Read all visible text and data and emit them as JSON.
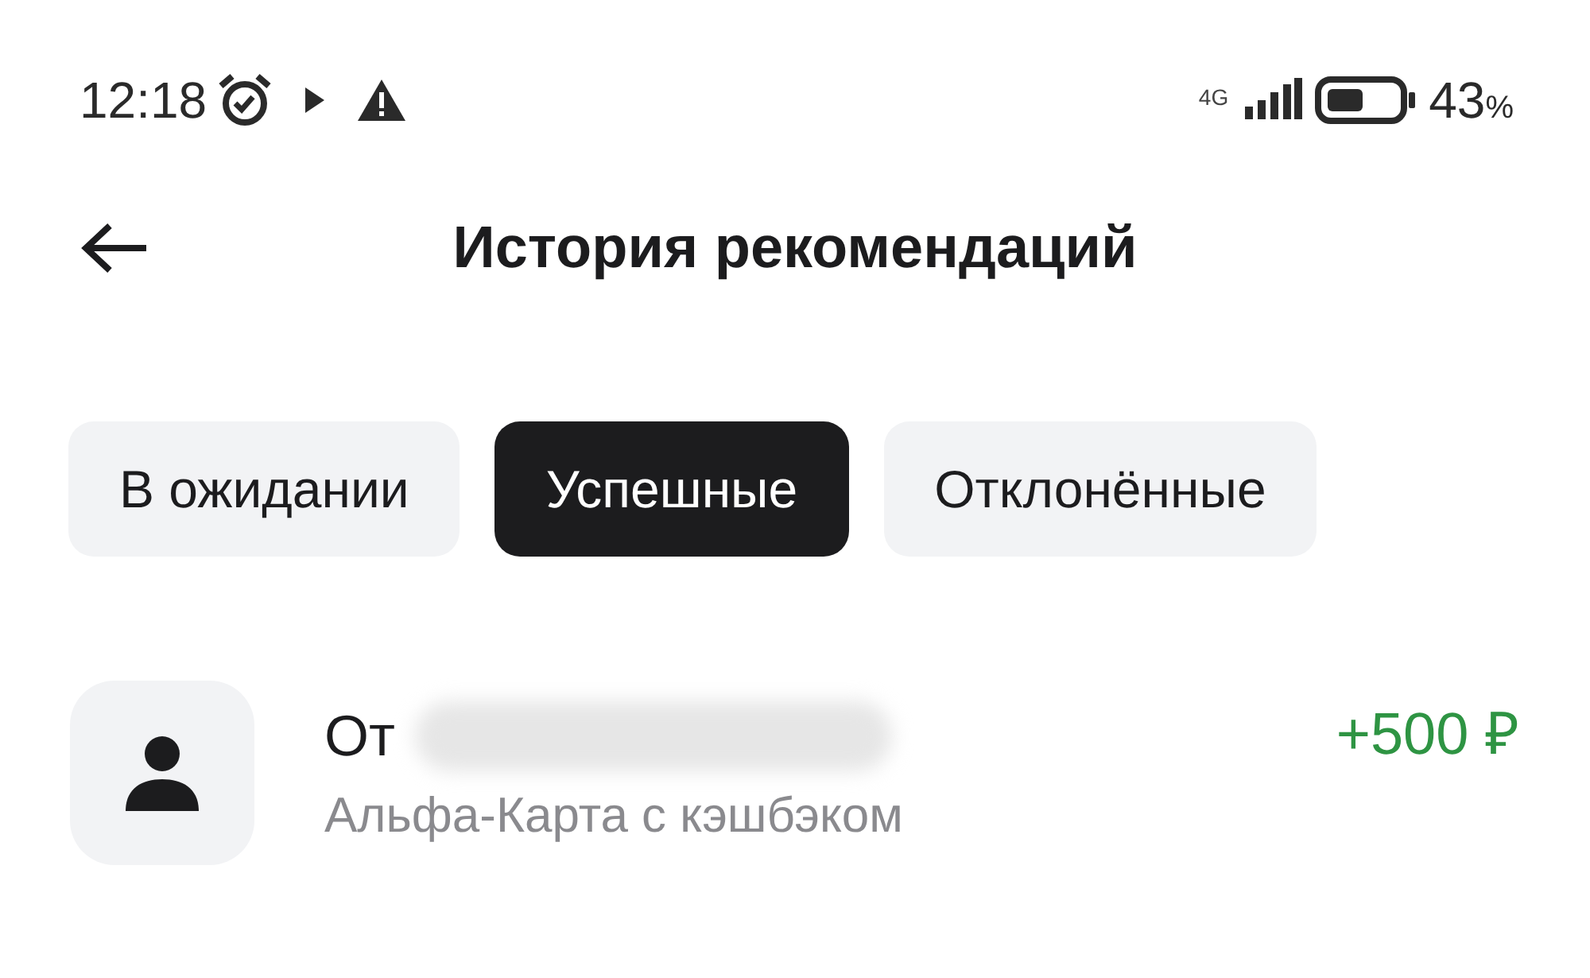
{
  "status_bar": {
    "time": "12:18",
    "network": "4G",
    "battery": "43",
    "battery_unit": "%"
  },
  "header": {
    "title": "История рекомендаций"
  },
  "tabs": [
    {
      "label": "В ожидании",
      "selected": false
    },
    {
      "label": "Успешные",
      "selected": true
    },
    {
      "label": "Отклонённые",
      "selected": false
    }
  ],
  "items": [
    {
      "title": "От",
      "subtitle": "Альфа-Карта с кэшбэком",
      "amount": "+500 ₽"
    }
  ]
}
